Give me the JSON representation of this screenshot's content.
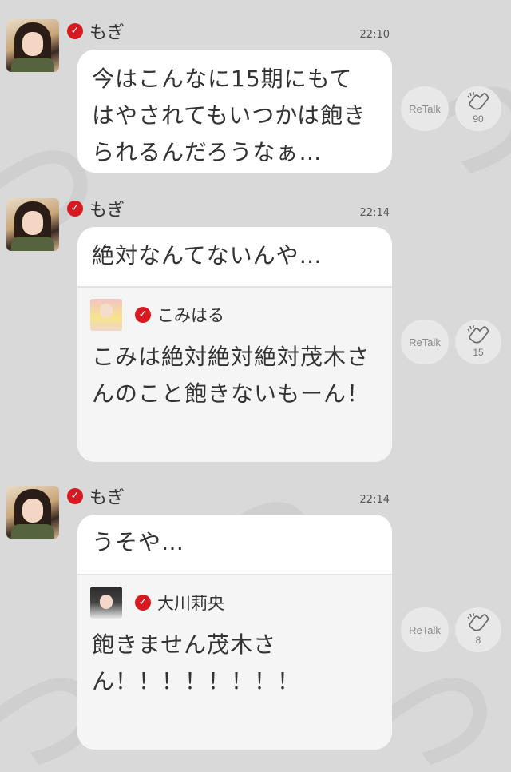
{
  "messages": [
    {
      "sender": "もぎ",
      "time": "22:10",
      "text": "今はこんなに15期にもてはやされてもいつかは飽きられるんだろうなぁ…",
      "retalk_label": "ReTalk",
      "clap_count": "90"
    },
    {
      "sender": "もぎ",
      "time": "22:14",
      "text": "絶対なんてないんや…",
      "quote": {
        "sender": "こみはる",
        "text": "こみは絶対絶対絶対茂木さんのこと飽きないもーん！"
      },
      "retalk_label": "ReTalk",
      "clap_count": "15"
    },
    {
      "sender": "もぎ",
      "time": "22:14",
      "text": "うそや…",
      "quote": {
        "sender": "大川莉央",
        "text": "飽きません茂木さん！！！！！！！！"
      },
      "retalk_label": "ReTalk",
      "clap_count": "8"
    }
  ],
  "icons": {
    "verified": "verified-check-icon",
    "clap": "clap-hands-icon"
  },
  "colors": {
    "background": "#d9d9d9",
    "bubble": "#ffffff",
    "quote_background": "#f5f5f5",
    "verified_red": "#d71a21"
  }
}
